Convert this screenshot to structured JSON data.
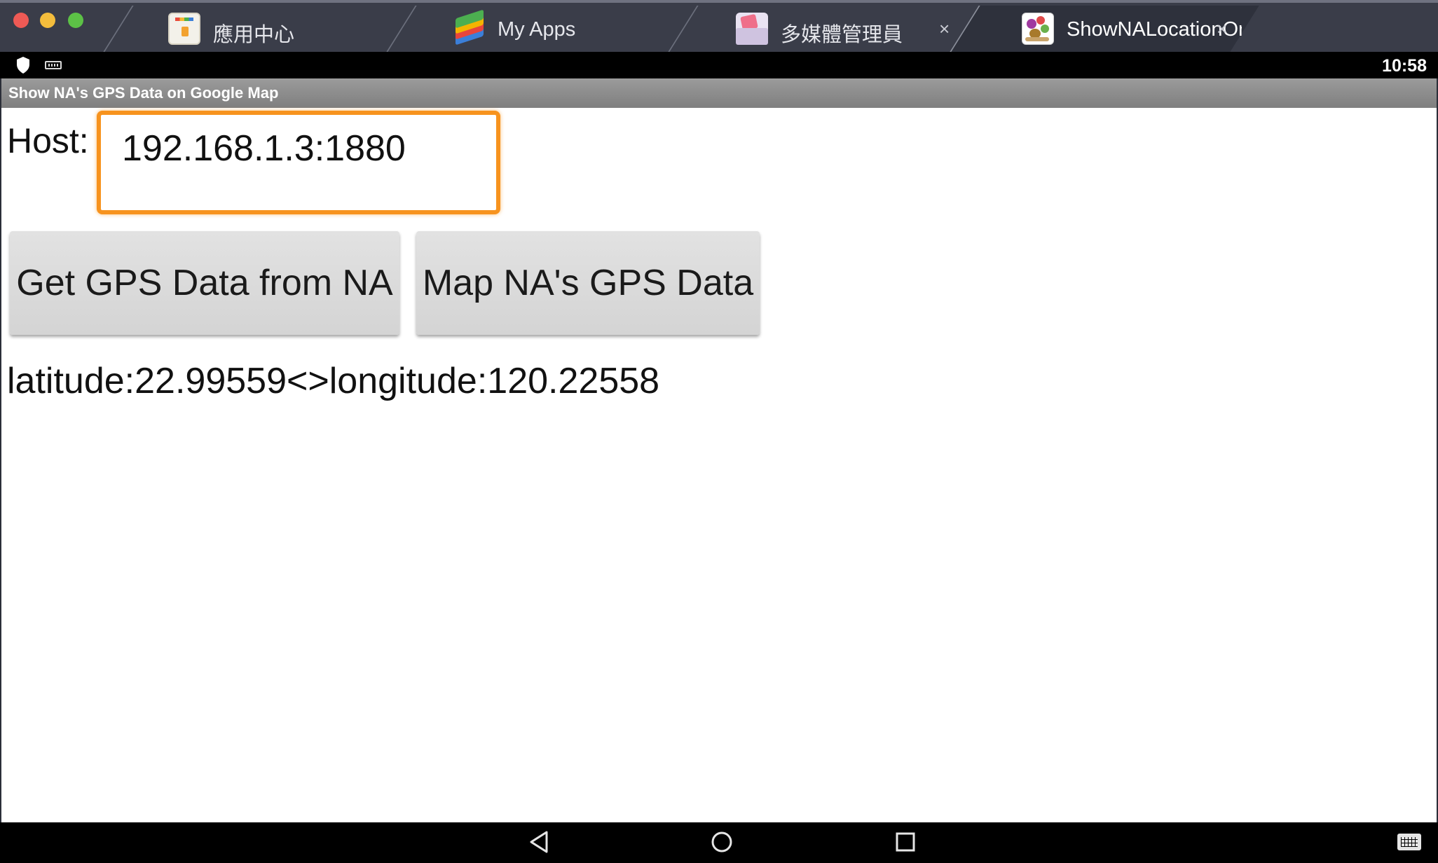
{
  "tabs": [
    {
      "label": "應用中心",
      "icon": "app-center-icon",
      "closable": false,
      "active": false
    },
    {
      "label": "My Apps",
      "icon": "my-apps-icon",
      "closable": false,
      "active": false
    },
    {
      "label": "多媒體管理員",
      "icon": "media-manager-icon",
      "closable": true,
      "active": false
    },
    {
      "label": "ShowNALocationOnG",
      "icon": "shownalocation-app-icon",
      "closable": true,
      "active": true
    }
  ],
  "tab_close_glyph": "×",
  "status_bar": {
    "time": "10:58"
  },
  "app": {
    "title": "Show NA's GPS Data on Google Map",
    "host_label": "Host:",
    "host_value": "192.168.1.3:1880",
    "get_button": "Get GPS Data from NA",
    "map_button": "Map NA's GPS Data",
    "gps_text": "latitude:22.99559<>longitude:120.22558"
  },
  "colors": {
    "input_focus": "#f7931e",
    "status_bar": "#000000",
    "title_bar": "#8c8c8c"
  }
}
